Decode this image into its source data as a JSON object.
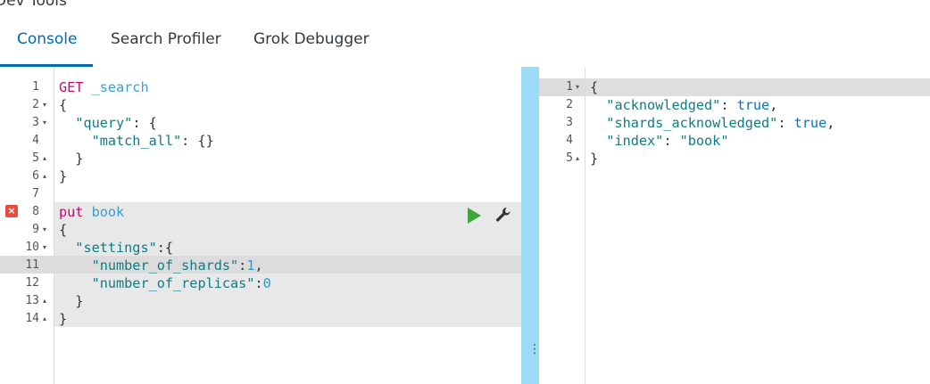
{
  "page": {
    "title": "Dev Tools"
  },
  "tabs": [
    {
      "label": "Console",
      "active": true
    },
    {
      "label": "Search Profiler",
      "active": false
    },
    {
      "label": "Grok Debugger",
      "active": false
    }
  ],
  "editor": {
    "line_numbers": [
      "1",
      "2",
      "3",
      "4",
      "5",
      "6",
      "7",
      "8",
      "9",
      "10",
      "11",
      "12",
      "13",
      "14"
    ],
    "fold_markers": [
      "",
      "▾",
      "▾",
      "",
      "▴",
      "▴",
      "",
      "",
      "▾",
      "▾",
      "",
      "",
      "▴",
      "▴"
    ],
    "lines": [
      [
        {
          "t": "GET",
          "c": "method"
        },
        {
          "t": " ",
          "c": "punct"
        },
        {
          "t": "_search",
          "c": "url"
        }
      ],
      [
        {
          "t": "{",
          "c": "punct"
        }
      ],
      [
        {
          "t": "  ",
          "c": "punct"
        },
        {
          "t": "\"query\"",
          "c": "key"
        },
        {
          "t": ": {",
          "c": "punct"
        }
      ],
      [
        {
          "t": "    ",
          "c": "punct"
        },
        {
          "t": "\"match_all\"",
          "c": "key"
        },
        {
          "t": ": {}",
          "c": "punct"
        }
      ],
      [
        {
          "t": "  }",
          "c": "punct"
        }
      ],
      [
        {
          "t": "}",
          "c": "punct"
        }
      ],
      [],
      [
        {
          "t": "put",
          "c": "method"
        },
        {
          "t": " ",
          "c": "punct"
        },
        {
          "t": "book",
          "c": "url"
        }
      ],
      [
        {
          "t": "{",
          "c": "punct"
        }
      ],
      [
        {
          "t": "  ",
          "c": "punct"
        },
        {
          "t": "\"settings\"",
          "c": "key"
        },
        {
          "t": ":{",
          "c": "punct"
        }
      ],
      [
        {
          "t": "    ",
          "c": "punct"
        },
        {
          "t": "\"number_of_shards\"",
          "c": "key"
        },
        {
          "t": ":",
          "c": "punct"
        },
        {
          "t": "1",
          "c": "num"
        },
        {
          "t": ",",
          "c": "punct"
        }
      ],
      [
        {
          "t": "    ",
          "c": "punct"
        },
        {
          "t": "\"number_of_replicas\"",
          "c": "key"
        },
        {
          "t": ":",
          "c": "punct"
        },
        {
          "t": "0",
          "c": "num"
        }
      ],
      [
        {
          "t": "  }",
          "c": "punct"
        }
      ],
      [
        {
          "t": "}",
          "c": "punct"
        }
      ]
    ],
    "error_marker": "×"
  },
  "output": {
    "line_numbers": [
      "1",
      "2",
      "3",
      "4",
      "5"
    ],
    "fold_markers": [
      "▾",
      "",
      "",
      "",
      "▴"
    ],
    "lines": [
      [
        {
          "t": "{",
          "c": "punct"
        }
      ],
      [
        {
          "t": "  ",
          "c": "punct"
        },
        {
          "t": "\"acknowledged\"",
          "c": "key"
        },
        {
          "t": ": ",
          "c": "punct"
        },
        {
          "t": "true",
          "c": "bool"
        },
        {
          "t": ",",
          "c": "punct"
        }
      ],
      [
        {
          "t": "  ",
          "c": "punct"
        },
        {
          "t": "\"shards_acknowledged\"",
          "c": "key"
        },
        {
          "t": ": ",
          "c": "punct"
        },
        {
          "t": "true",
          "c": "bool"
        },
        {
          "t": ",",
          "c": "punct"
        }
      ],
      [
        {
          "t": "  ",
          "c": "punct"
        },
        {
          "t": "\"index\"",
          "c": "key"
        },
        {
          "t": ": ",
          "c": "punct"
        },
        {
          "t": "\"book\"",
          "c": "str"
        }
      ],
      [
        {
          "t": "}",
          "c": "punct"
        }
      ]
    ]
  },
  "splitter": {
    "handle": "⋮"
  },
  "colors": {
    "accent": "#006bb4",
    "method": "#c80a68",
    "url": "#3b9ecf",
    "key": "#0e7c86",
    "number": "#25a0d6",
    "splitter": "#9bdbf7",
    "play": "#3fa53d",
    "error": "#e74c3c"
  }
}
